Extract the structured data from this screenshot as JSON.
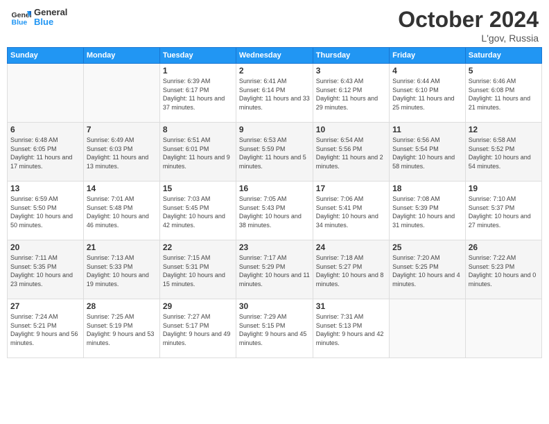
{
  "header": {
    "logo_line1": "General",
    "logo_line2": "Blue",
    "month_title": "October 2024",
    "location": "L'gov, Russia"
  },
  "calendar": {
    "days_of_week": [
      "Sunday",
      "Monday",
      "Tuesday",
      "Wednesday",
      "Thursday",
      "Friday",
      "Saturday"
    ],
    "weeks": [
      [
        {
          "day": "",
          "info": ""
        },
        {
          "day": "",
          "info": ""
        },
        {
          "day": "1",
          "info": "Sunrise: 6:39 AM\nSunset: 6:17 PM\nDaylight: 11 hours and 37 minutes."
        },
        {
          "day": "2",
          "info": "Sunrise: 6:41 AM\nSunset: 6:14 PM\nDaylight: 11 hours and 33 minutes."
        },
        {
          "day": "3",
          "info": "Sunrise: 6:43 AM\nSunset: 6:12 PM\nDaylight: 11 hours and 29 minutes."
        },
        {
          "day": "4",
          "info": "Sunrise: 6:44 AM\nSunset: 6:10 PM\nDaylight: 11 hours and 25 minutes."
        },
        {
          "day": "5",
          "info": "Sunrise: 6:46 AM\nSunset: 6:08 PM\nDaylight: 11 hours and 21 minutes."
        }
      ],
      [
        {
          "day": "6",
          "info": "Sunrise: 6:48 AM\nSunset: 6:05 PM\nDaylight: 11 hours and 17 minutes."
        },
        {
          "day": "7",
          "info": "Sunrise: 6:49 AM\nSunset: 6:03 PM\nDaylight: 11 hours and 13 minutes."
        },
        {
          "day": "8",
          "info": "Sunrise: 6:51 AM\nSunset: 6:01 PM\nDaylight: 11 hours and 9 minutes."
        },
        {
          "day": "9",
          "info": "Sunrise: 6:53 AM\nSunset: 5:59 PM\nDaylight: 11 hours and 5 minutes."
        },
        {
          "day": "10",
          "info": "Sunrise: 6:54 AM\nSunset: 5:56 PM\nDaylight: 11 hours and 2 minutes."
        },
        {
          "day": "11",
          "info": "Sunrise: 6:56 AM\nSunset: 5:54 PM\nDaylight: 10 hours and 58 minutes."
        },
        {
          "day": "12",
          "info": "Sunrise: 6:58 AM\nSunset: 5:52 PM\nDaylight: 10 hours and 54 minutes."
        }
      ],
      [
        {
          "day": "13",
          "info": "Sunrise: 6:59 AM\nSunset: 5:50 PM\nDaylight: 10 hours and 50 minutes."
        },
        {
          "day": "14",
          "info": "Sunrise: 7:01 AM\nSunset: 5:48 PM\nDaylight: 10 hours and 46 minutes."
        },
        {
          "day": "15",
          "info": "Sunrise: 7:03 AM\nSunset: 5:45 PM\nDaylight: 10 hours and 42 minutes."
        },
        {
          "day": "16",
          "info": "Sunrise: 7:05 AM\nSunset: 5:43 PM\nDaylight: 10 hours and 38 minutes."
        },
        {
          "day": "17",
          "info": "Sunrise: 7:06 AM\nSunset: 5:41 PM\nDaylight: 10 hours and 34 minutes."
        },
        {
          "day": "18",
          "info": "Sunrise: 7:08 AM\nSunset: 5:39 PM\nDaylight: 10 hours and 31 minutes."
        },
        {
          "day": "19",
          "info": "Sunrise: 7:10 AM\nSunset: 5:37 PM\nDaylight: 10 hours and 27 minutes."
        }
      ],
      [
        {
          "day": "20",
          "info": "Sunrise: 7:11 AM\nSunset: 5:35 PM\nDaylight: 10 hours and 23 minutes."
        },
        {
          "day": "21",
          "info": "Sunrise: 7:13 AM\nSunset: 5:33 PM\nDaylight: 10 hours and 19 minutes."
        },
        {
          "day": "22",
          "info": "Sunrise: 7:15 AM\nSunset: 5:31 PM\nDaylight: 10 hours and 15 minutes."
        },
        {
          "day": "23",
          "info": "Sunrise: 7:17 AM\nSunset: 5:29 PM\nDaylight: 10 hours and 11 minutes."
        },
        {
          "day": "24",
          "info": "Sunrise: 7:18 AM\nSunset: 5:27 PM\nDaylight: 10 hours and 8 minutes."
        },
        {
          "day": "25",
          "info": "Sunrise: 7:20 AM\nSunset: 5:25 PM\nDaylight: 10 hours and 4 minutes."
        },
        {
          "day": "26",
          "info": "Sunrise: 7:22 AM\nSunset: 5:23 PM\nDaylight: 10 hours and 0 minutes."
        }
      ],
      [
        {
          "day": "27",
          "info": "Sunrise: 7:24 AM\nSunset: 5:21 PM\nDaylight: 9 hours and 56 minutes."
        },
        {
          "day": "28",
          "info": "Sunrise: 7:25 AM\nSunset: 5:19 PM\nDaylight: 9 hours and 53 minutes."
        },
        {
          "day": "29",
          "info": "Sunrise: 7:27 AM\nSunset: 5:17 PM\nDaylight: 9 hours and 49 minutes."
        },
        {
          "day": "30",
          "info": "Sunrise: 7:29 AM\nSunset: 5:15 PM\nDaylight: 9 hours and 45 minutes."
        },
        {
          "day": "31",
          "info": "Sunrise: 7:31 AM\nSunset: 5:13 PM\nDaylight: 9 hours and 42 minutes."
        },
        {
          "day": "",
          "info": ""
        },
        {
          "day": "",
          "info": ""
        }
      ]
    ]
  }
}
